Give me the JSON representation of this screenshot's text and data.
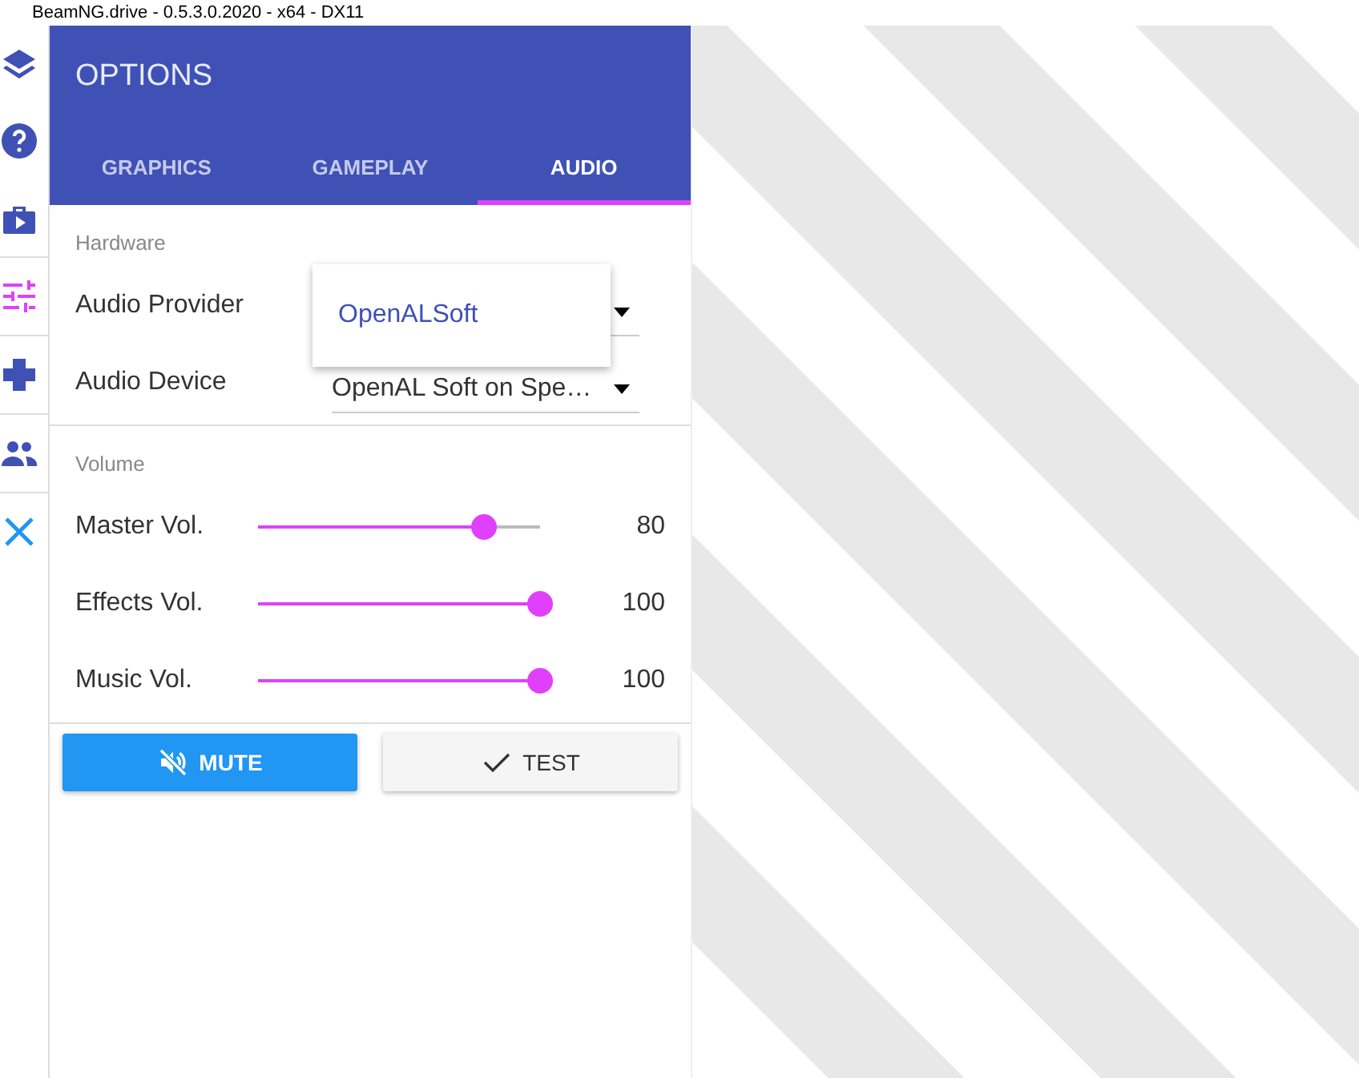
{
  "window": {
    "title": "BeamNG.drive - 0.5.3.0.2020 - x64 - DX11"
  },
  "sidebar": {
    "items": [
      {
        "selected": false
      },
      {
        "selected": false
      },
      {
        "selected": false
      },
      {
        "selected": true
      },
      {
        "selected": false
      },
      {
        "selected": false
      },
      {
        "selected": false
      }
    ]
  },
  "panel": {
    "title": "OPTIONS",
    "tabs": [
      {
        "label": "GRAPHICS",
        "selected": false
      },
      {
        "label": "GAMEPLAY",
        "selected": false
      },
      {
        "label": "AUDIO",
        "selected": true
      }
    ],
    "sections": [
      {
        "heading": "Hardware",
        "rows": [
          {
            "kind": "select",
            "label": "Audio Provider",
            "expanded": true,
            "options": [
              {
                "label": "OpenALSoft",
                "selected": true
              }
            ]
          },
          {
            "kind": "select",
            "label": "Audio Device",
            "value": "OpenAL Soft on Spe…",
            "expanded": false
          }
        ]
      },
      {
        "heading": "Volume",
        "rows": [
          {
            "kind": "slider",
            "label": "Master Vol.",
            "level": 0.8,
            "reading": "80"
          },
          {
            "kind": "slider",
            "label": "Effects Vol.",
            "level": 1,
            "reading": "100"
          },
          {
            "kind": "slider",
            "label": "Music Vol.",
            "level": 1,
            "reading": "100"
          }
        ]
      }
    ],
    "buttons": [
      {
        "label": "MUTE",
        "kind": "primary"
      },
      {
        "label": "TEST",
        "kind": "secondary"
      }
    ]
  }
}
